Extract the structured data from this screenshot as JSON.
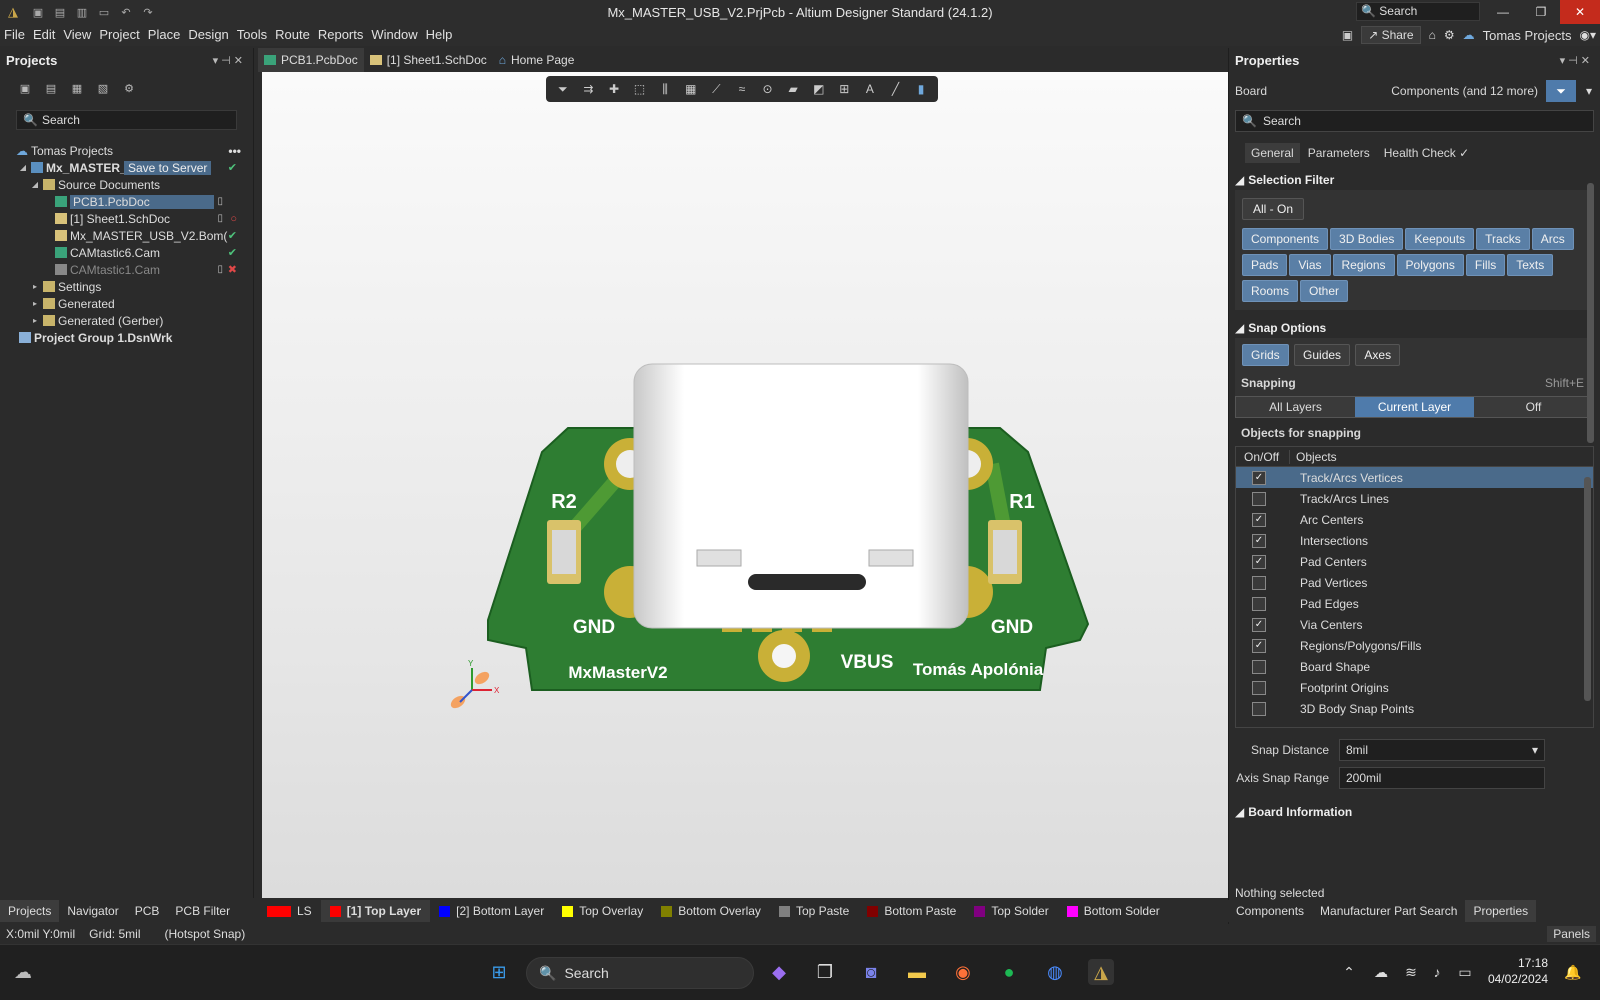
{
  "titlebar": {
    "title": "Mx_MASTER_USB_V2.PrjPcb - Altium Designer Standard (24.1.2)",
    "search_placeholder": "Search"
  },
  "menu": {
    "items": [
      "File",
      "Edit",
      "View",
      "Project",
      "Place",
      "Design",
      "Tools",
      "Route",
      "Reports",
      "Window",
      "Help"
    ],
    "share_label": "Share",
    "account_label": "Tomas Projects"
  },
  "projects_panel": {
    "title": "Projects",
    "search_placeholder": "Search",
    "workspace": "Tomas Projects",
    "project_name": "Mx_MASTER_U",
    "save_to_server": "Save to Server",
    "source_folder": "Source Documents",
    "files": [
      {
        "name": "PCB1.PcbDoc"
      },
      {
        "name": "[1] Sheet1.SchDoc"
      },
      {
        "name": "Mx_MASTER_USB_V2.Bom("
      },
      {
        "name": "CAMtastic6.Cam"
      },
      {
        "name": "CAMtastic1.Cam"
      }
    ],
    "folders": [
      "Settings",
      "Generated",
      "Generated (Gerber)"
    ],
    "project_group": "Project Group 1.DsnWrk"
  },
  "left_bottom_tabs": [
    "Projects",
    "Navigator",
    "PCB",
    "PCB Filter"
  ],
  "doc_tabs": [
    "PCB1.PcbDoc",
    "[1] Sheet1.SchDoc",
    "Home Page"
  ],
  "pcb": {
    "label_r2": "R2",
    "label_r1": "R1",
    "label_gnd_left": "GND",
    "label_gnd_right": "GND",
    "label_vbus": "VBUS",
    "label_name_left": "MxMasterV2",
    "label_name_right": "Tomás Apolónia",
    "axis_x": "X",
    "axis_y": "Y"
  },
  "layers": [
    {
      "name": "LS",
      "color": "#ff0000"
    },
    {
      "name": "[1] Top Layer",
      "color": "#ff0000",
      "active": true
    },
    {
      "name": "[2] Bottom Layer",
      "color": "#0000ff"
    },
    {
      "name": "Top Overlay",
      "color": "#ffff00"
    },
    {
      "name": "Bottom Overlay",
      "color": "#808000"
    },
    {
      "name": "Top Paste",
      "color": "#808080"
    },
    {
      "name": "Bottom Paste",
      "color": "#800000"
    },
    {
      "name": "Top Solder",
      "color": "#800080"
    },
    {
      "name": "Bottom Solder",
      "color": "#ff00ff"
    }
  ],
  "statusbar": {
    "coords": "X:0mil Y:0mil",
    "grid": "Grid: 5mil",
    "snap": "(Hotspot Snap)",
    "panels_label": "Panels"
  },
  "properties": {
    "title": "Properties",
    "board_label": "Board",
    "filter_summary": "Components (and 12 more)",
    "search_placeholder": "Search",
    "tabs": [
      "General",
      "Parameters",
      "Health Check"
    ],
    "selection_filter_title": "Selection Filter",
    "all_on": "All - On",
    "filter_chips": [
      "Components",
      "3D Bodies",
      "Keepouts",
      "Tracks",
      "Arcs",
      "Pads",
      "Vias",
      "Regions",
      "Polygons",
      "Fills",
      "Texts",
      "Rooms",
      "Other"
    ],
    "snap_options_title": "Snap Options",
    "snap_buttons": [
      "Grids",
      "Guides",
      "Axes"
    ],
    "snapping_label": "Snapping",
    "snapping_shortcut": "Shift+E",
    "snapping_modes": [
      "All Layers",
      "Current Layer",
      "Off"
    ],
    "objects_for_snapping_title": "Objects for snapping",
    "col_onoff": "On/Off",
    "col_objects": "Objects",
    "objects": [
      {
        "name": "Track/Arcs Vertices",
        "checked": true
      },
      {
        "name": "Track/Arcs Lines",
        "checked": false
      },
      {
        "name": "Arc Centers",
        "checked": true
      },
      {
        "name": "Intersections",
        "checked": true
      },
      {
        "name": "Pad Centers",
        "checked": true
      },
      {
        "name": "Pad Vertices",
        "checked": false
      },
      {
        "name": "Pad Edges",
        "checked": false
      },
      {
        "name": "Via Centers",
        "checked": true
      },
      {
        "name": "Regions/Polygons/Fills",
        "checked": true
      },
      {
        "name": "Board Shape",
        "checked": false
      },
      {
        "name": "Footprint Origins",
        "checked": false
      },
      {
        "name": "3D Body Snap Points",
        "checked": false
      }
    ],
    "snap_distance_label": "Snap Distance",
    "snap_distance_value": "8mil",
    "axis_snap_label": "Axis Snap Range",
    "axis_snap_value": "200mil",
    "board_info_title": "Board Information",
    "nothing_selected": "Nothing selected"
  },
  "right_bottom_tabs": [
    "Components",
    "Manufacturer Part Search",
    "Properties"
  ],
  "taskbar": {
    "search_label": "Search",
    "time": "17:18",
    "date": "04/02/2024"
  }
}
